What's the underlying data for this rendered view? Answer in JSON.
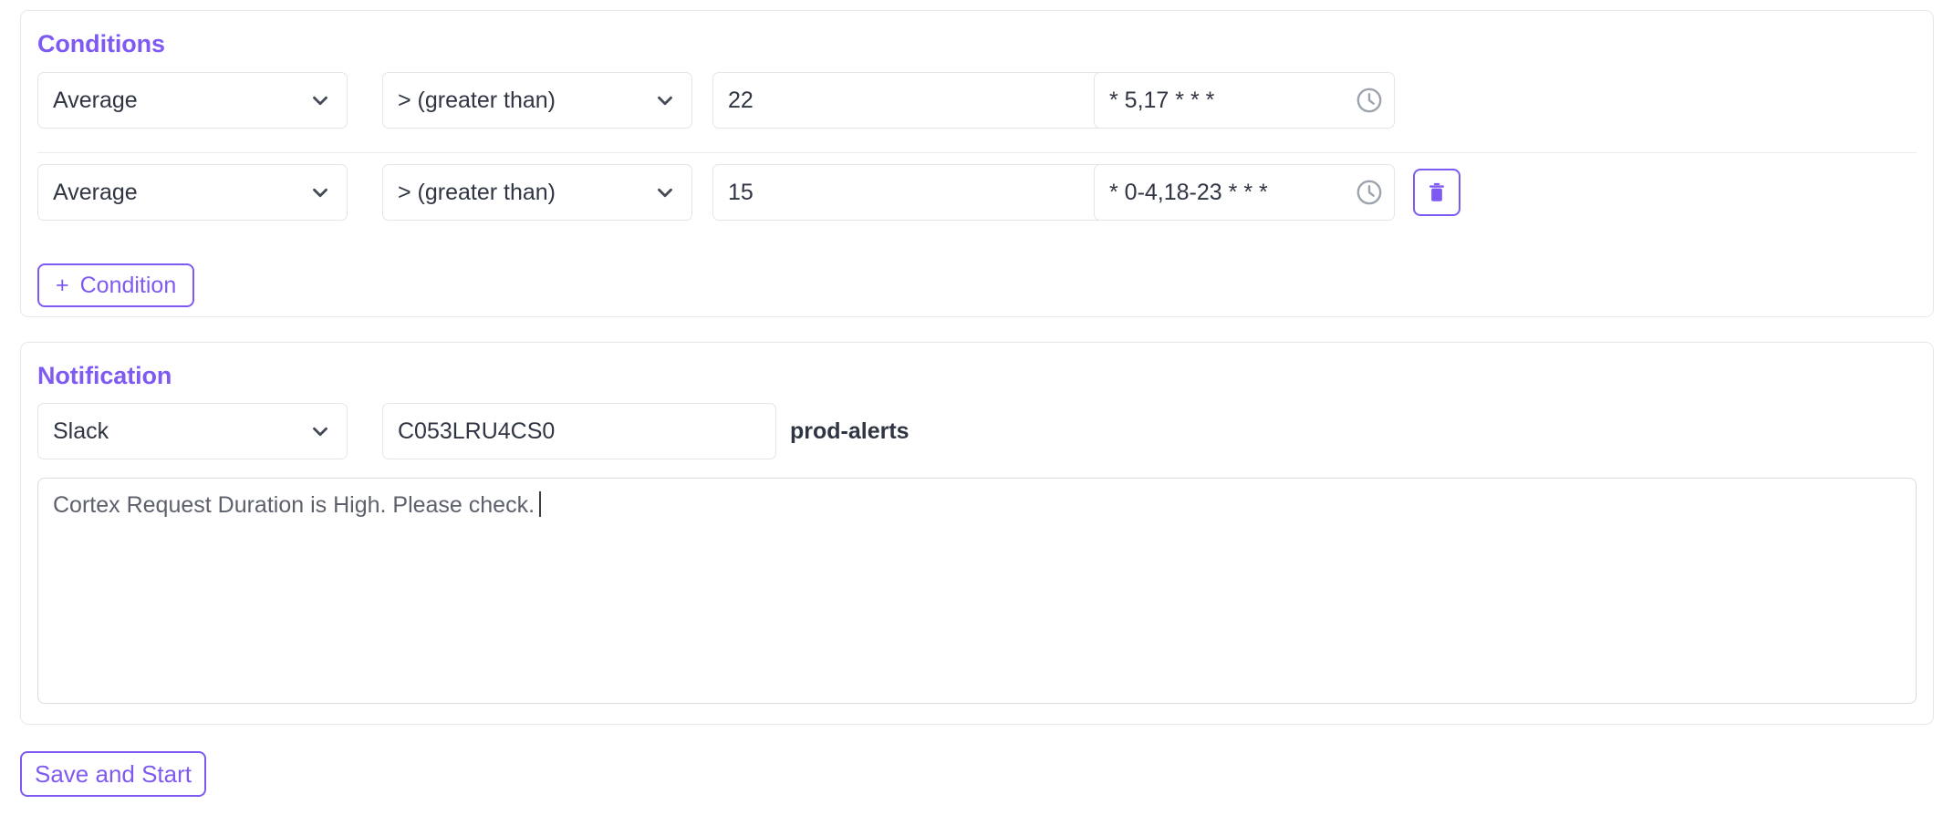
{
  "conditions": {
    "title": "Conditions",
    "add_button": {
      "plus": "+",
      "label": "Condition"
    },
    "rows": [
      {
        "aggregation": "Average",
        "operator": "> (greater than)",
        "threshold": "22",
        "schedule": "* 5,17 * * *",
        "clock_icon": "clock-icon",
        "has_delete": false
      },
      {
        "aggregation": "Average",
        "operator": "> (greater than)",
        "threshold": "15",
        "schedule": "* 0-4,18-23 * * *",
        "clock_icon": "clock-icon",
        "has_delete": true,
        "delete_icon": "trash-icon"
      }
    ]
  },
  "notification": {
    "title": "Notification",
    "channel": "Slack",
    "target_id": "C053LRU4CS0",
    "target_name": "prod-alerts",
    "message": "Cortex Request Duration is High. Please check."
  },
  "footer": {
    "save_label": "Save and Start"
  },
  "colors": {
    "accent": "#7f5af2",
    "text": "#2f3542",
    "muted": "#5c616b",
    "border": "#e3e5e9",
    "panel_border": "#e6e8ec"
  }
}
